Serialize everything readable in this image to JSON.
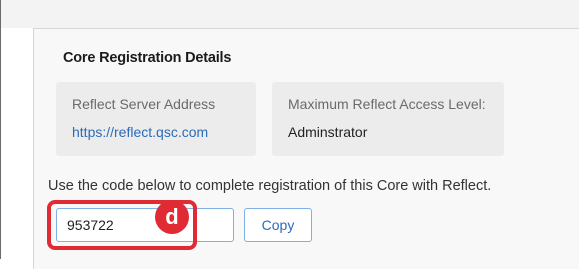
{
  "section": {
    "title": "Core Registration Details"
  },
  "server_card": {
    "label": "Reflect Server Address",
    "value": "https://reflect.qsc.com"
  },
  "access_card": {
    "label": "Maximum Reflect Access Level:",
    "value": "Adminstrator"
  },
  "instruction": "Use the code below to complete registration of this Core with Reflect.",
  "code_field": {
    "value": "953722"
  },
  "copy_button": {
    "label": "Copy"
  },
  "annotation": {
    "badge": "d",
    "color": "#e02b34"
  },
  "colors": {
    "link": "#2b6bb8",
    "input_border": "#7fb0e6"
  }
}
